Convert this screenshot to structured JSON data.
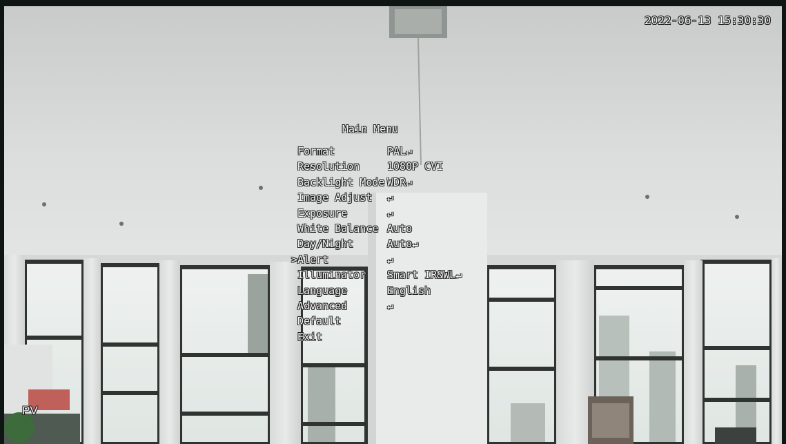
{
  "osd": {
    "timestamp": "2022-06-13 15:30:30",
    "menu_title": "Main Menu",
    "cursor_glyph": ">",
    "selected_index": 7,
    "items": [
      {
        "label": "Format",
        "value": "PAL↵"
      },
      {
        "label": "Resolution",
        "value": "1080P CVI"
      },
      {
        "label": "Backlight Mode",
        "value": "WDR↵"
      },
      {
        "label": "Image Adjust",
        "value": "↵"
      },
      {
        "label": "Exposure",
        "value": "↵"
      },
      {
        "label": "White Balance",
        "value": "Auto"
      },
      {
        "label": "Day/Night",
        "value": "Auto↵"
      },
      {
        "label": "Alert",
        "value": "↵"
      },
      {
        "label": "Illuminator",
        "value": "Smart IR&WL↵"
      },
      {
        "label": "Language",
        "value": "English"
      },
      {
        "label": "Advanced",
        "value": "↵"
      },
      {
        "label": "Default",
        "value": ""
      },
      {
        "label": "Exit",
        "value": ""
      }
    ],
    "corner_tag": "PV"
  },
  "colors": {
    "osd_text": "#f4f4f4",
    "osd_outline": "#222222",
    "ceiling": "#dcdedc",
    "window_frame": "#2f3431",
    "column": "#bfc2c0"
  }
}
